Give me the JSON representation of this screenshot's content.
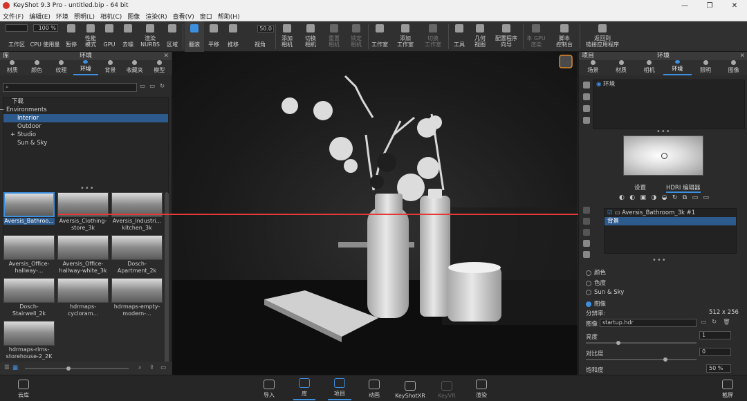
{
  "window": {
    "title": "KeyShot 9.3 Pro  - untitled.bip  - 64 bit",
    "controls": [
      "—",
      "❐",
      "✕"
    ]
  },
  "menu": [
    "文件(F)",
    "编辑(E)",
    "环境",
    "照明(L)",
    "相机(C)",
    "图像",
    "渲染(R)",
    "查看(V)",
    "窗口",
    "帮助(H)"
  ],
  "toolbar": {
    "percent": "100 %",
    "fov": "50.0",
    "items": [
      "工作区",
      "CPU 使用量",
      "暂停",
      "性能\n模式",
      "GPU",
      "去噪",
      "渲染\nNURBS",
      "区域",
      "翻滚",
      "平移",
      "推移",
      "视角",
      "添加\n相机",
      "切换\n相机",
      "重置\n相机",
      "锁定\n相机",
      "工作室",
      "添加\n工作室",
      "切换\n工作室",
      "工具",
      "几何\n视图",
      "配置程序\n向导",
      "本 GPU\n渲染",
      "脚本\n控制台",
      "返回到\n链接应用程序"
    ]
  },
  "left_panel": {
    "title": "环境",
    "header_label": "库",
    "tabs": [
      "材质",
      "颜色",
      "纹理",
      "环境",
      "背景",
      "收藏夹",
      "模型"
    ],
    "active_tab": "环境",
    "search_placeholder": "",
    "tree": [
      {
        "label": "下载",
        "indent": 1,
        "selected": false
      },
      {
        "label": "Environments",
        "indent": 0,
        "prefix": "−",
        "selected": false
      },
      {
        "label": "Interior",
        "indent": 2,
        "selected": true
      },
      {
        "label": "Outdoor",
        "indent": 2,
        "selected": false
      },
      {
        "label": "Studio",
        "indent": 2,
        "prefix": "+",
        "selected": false
      },
      {
        "label": "Sun & Sky",
        "indent": 2,
        "selected": false
      }
    ],
    "thumbnails": [
      {
        "label": "Aversis_Bathroo...",
        "selected": true
      },
      {
        "label": "Aversis_Clothing-\nstore_3k",
        "selected": false
      },
      {
        "label": "Aversis_Industri...\nkitchen_3k",
        "selected": false
      },
      {
        "label": "Aversis_Office-\nhallway-...",
        "selected": false
      },
      {
        "label": "Aversis_Office-\nhallway-white_3k",
        "selected": false
      },
      {
        "label": "Dosch-\nApartment_2k",
        "selected": false
      },
      {
        "label": "Dosch-\nStairwell_2k",
        "selected": false
      },
      {
        "label": "hdrmaps-\ncycloram...",
        "selected": false
      },
      {
        "label": "hdrmaps-empty-\nmodern-...",
        "selected": false
      },
      {
        "label": "hdrmaps-rims-\nstorehouse-2_2K",
        "selected": false
      }
    ]
  },
  "right_panel": {
    "header_label": "项目",
    "title": "环境",
    "tabs": [
      "场景",
      "材质",
      "相机",
      "环境",
      "照明",
      "图像"
    ],
    "active_tab": "环境",
    "env_list": [
      "环境"
    ],
    "subtabs": [
      "设置",
      "HDRI 编辑器"
    ],
    "active_subtab": "HDRI 编辑器",
    "layers": [
      {
        "label": "Aversis_Bathroom_3k #1",
        "checked": true,
        "selected": false
      },
      {
        "label": "背景",
        "selected": true
      }
    ],
    "background_options": [
      {
        "label": "颜色",
        "on": false
      },
      {
        "label": "色度",
        "on": false
      },
      {
        "label": "Sun & Sky",
        "on": false
      },
      {
        "label": "图像",
        "on": true
      }
    ],
    "resolution_label": "分辨率:",
    "resolution_value": "512 x 256",
    "image_label": "图像",
    "image_value": "startup.hdr",
    "brightness_label": "亮度",
    "brightness_value": "1",
    "contrast_label": "对比度",
    "contrast_value": "0",
    "saturation_label": "饱和度",
    "saturation_value": "50 %"
  },
  "bottom_bar": [
    {
      "label": "云库",
      "state": "normal"
    },
    {
      "label": "导入",
      "state": "normal"
    },
    {
      "label": "库",
      "state": "on"
    },
    {
      "label": "项目",
      "state": "on"
    },
    {
      "label": "动画",
      "state": "normal"
    },
    {
      "label": "KeyShotXR",
      "state": "normal"
    },
    {
      "label": "KeyVR",
      "state": "dis"
    },
    {
      "label": "渲染",
      "state": "normal"
    },
    {
      "label": "截屏",
      "state": "normal"
    }
  ],
  "colors": {
    "accent": "#3d8fe0",
    "selection": "#2d5b8e",
    "arrow": "#e53935"
  }
}
